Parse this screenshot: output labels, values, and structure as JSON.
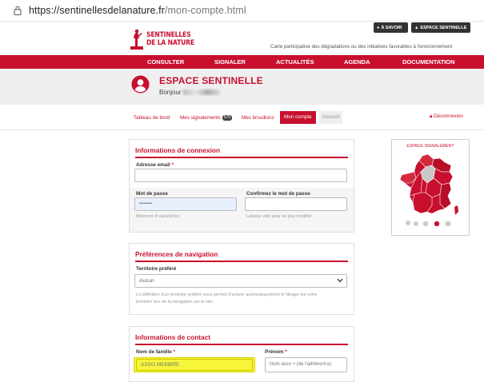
{
  "browser": {
    "url_host": "https://sentinellesdelanature.fr",
    "url_path": "/mon-compte.html"
  },
  "header": {
    "logo_line1": "SENTINELLES",
    "logo_line2": "DE LA NATURE",
    "btn_savoir": "À SAVOIR",
    "btn_espace": "ESPACE SENTINELLE",
    "tagline": "Carte participative des dégradations ou des initiatives favorables à l'environnement"
  },
  "nav": {
    "items": [
      "CONSULTER",
      "SIGNALER",
      "ACTUALITÉS",
      "AGENDA",
      "DOCUMENTATION"
    ]
  },
  "banner": {
    "title": "ESPACE SENTINELLE",
    "hello": "Bonjour"
  },
  "subnav": {
    "tableau": "Tableau de bord",
    "signalements": "Mes signalements",
    "signalements_count": "576",
    "brouillons": "Mes brouillons",
    "compte": "Mon compte",
    "intranet": "Intranet",
    "logout": "Déconnexion"
  },
  "connexion": {
    "title": "Informations de connexion",
    "email_label": "Adresse email",
    "email_value": "",
    "password_label": "Mot de passe",
    "password_value": "•••••••••",
    "password_help": "Minimum 8 caractères",
    "confirm_label": "Confirmez le mot de passe",
    "confirm_value": "",
    "confirm_help": "Laissez vide pour ne pas modifier"
  },
  "preferences": {
    "title": "Préférences de navigation",
    "territoire_label": "Territoire préféré",
    "territoire_value": "Aucun",
    "help_line1": "La définition d'un territoire préféré vous permet d'activer automatiquement le filtrage sur votre",
    "help_line2": "territoire lors de la navigation sur le site."
  },
  "contact": {
    "title": "Informations de contact",
    "nom_label": "Nom de famille",
    "nom_value": "ASSO MEMBRE",
    "prenom_label": "Prénom",
    "prenom_value": "Nom asso + (de l'adhérent.e)"
  },
  "map": {
    "title": "ESPACE SIGNALEMENT",
    "accent": "#c8102e"
  },
  "colors": {
    "brand_red": "#c8102e",
    "highlight": "#f6f53a"
  }
}
